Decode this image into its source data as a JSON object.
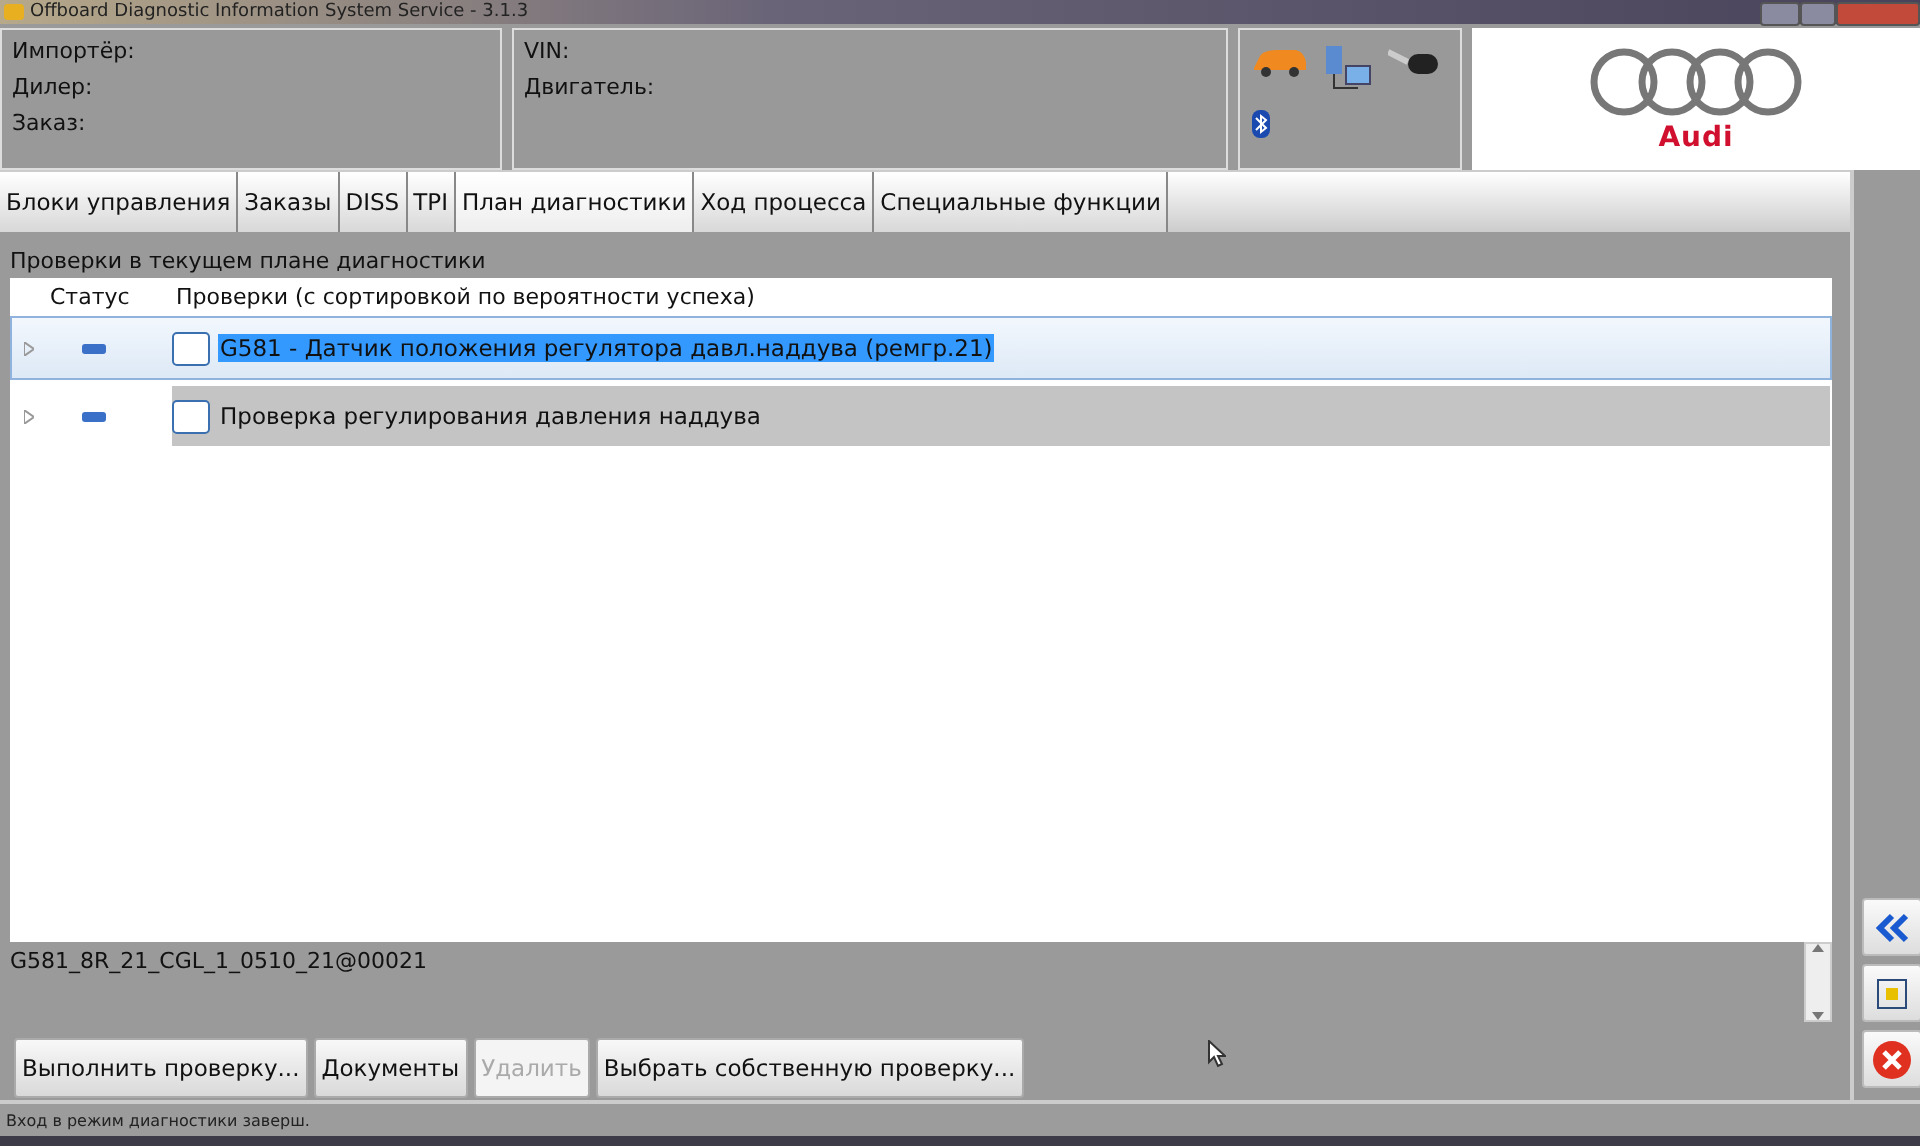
{
  "window": {
    "title": "Offboard Diagnostic Information System Service - 3.1.3"
  },
  "header": {
    "left_fields": [
      "Импортёр:",
      "Дилер:",
      "Заказ:"
    ],
    "right_fields": [
      "VIN:",
      "Двигатель:"
    ],
    "brand": "Audi"
  },
  "tabs": [
    {
      "label": "Блоки управления",
      "selected": false
    },
    {
      "label": "Заказы",
      "selected": false
    },
    {
      "label": "DISS",
      "selected": false
    },
    {
      "label": "TPI",
      "selected": false
    },
    {
      "label": "План диагностики",
      "selected": true
    },
    {
      "label": "Ход процесса",
      "selected": false
    },
    {
      "label": "Специальные функции",
      "selected": false
    }
  ],
  "section_title": "Проверки в текущем плане диагностики",
  "table": {
    "columns": [
      "Статус",
      "Проверки (с сортировкой по вероятности успеха)"
    ],
    "rows": [
      {
        "test": "G581 - Датчик положения регулятора давл.наддува (ремгр.21)",
        "selected": true
      },
      {
        "test": "Проверка регулирования давления наддува",
        "selected": false
      }
    ]
  },
  "detail": "G581_8R_21_CGL_1_0510_21@00021",
  "buttons": [
    {
      "label": "Выполнить проверку...",
      "disabled": false
    },
    {
      "label": "Документы",
      "disabled": false
    },
    {
      "label": "Удалить",
      "disabled": true
    },
    {
      "label": "Выбрать собственную проверку...",
      "disabled": false
    }
  ],
  "status_bar": "Вход в режим диагностики заверш."
}
